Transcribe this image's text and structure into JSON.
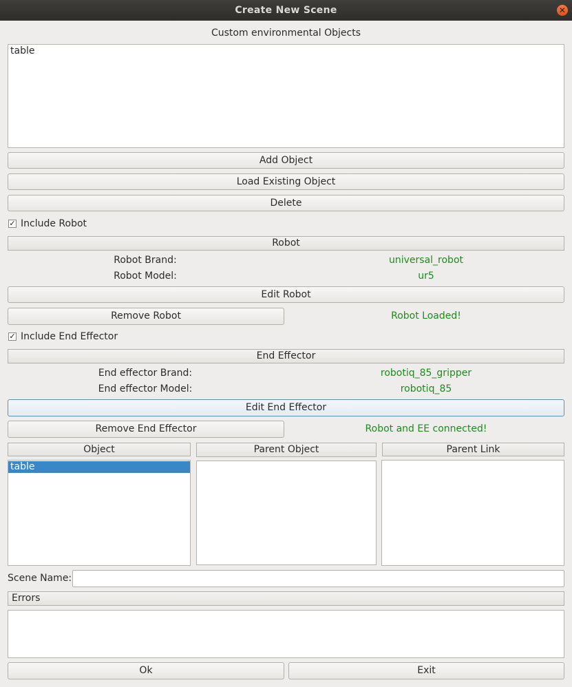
{
  "window": {
    "title": "Create New Scene",
    "close_glyph": "✕"
  },
  "objects_section": {
    "label": "Custom environmental Objects",
    "items": [
      "table"
    ]
  },
  "buttons": {
    "add_object": "Add Object",
    "load_existing": "Load Existing Object",
    "delete": "Delete",
    "edit_robot": "Edit Robot",
    "remove_robot": "Remove Robot",
    "edit_end_effector": "Edit End Effector",
    "remove_end_effector": "Remove End Effector",
    "ok": "Ok",
    "exit": "Exit"
  },
  "robot": {
    "include_label": "Include Robot",
    "include_checked": true,
    "header": "Robot",
    "brand_label": "Robot Brand:",
    "brand_value": "universal_robot",
    "model_label": "Robot Model:",
    "model_value": "ur5",
    "status": "Robot Loaded!"
  },
  "end_effector": {
    "include_label": "Include End Effector",
    "include_checked": true,
    "header": "End Effector",
    "brand_label": "End effector Brand:",
    "brand_value": "robotiq_85_gripper",
    "model_label": "End effector Model:",
    "model_value": "robotiq_85",
    "status": "Robot and EE connected!"
  },
  "parenting": {
    "object_header": "Object",
    "parent_object_header": "Parent Object",
    "parent_link_header": "Parent Link",
    "objects": [
      "table"
    ],
    "selected_object": "table"
  },
  "scene": {
    "name_label": "Scene Name:",
    "name_value": ""
  },
  "errors": {
    "header": "Errors"
  },
  "colors": {
    "status_green": "#1f8a1f",
    "selection_blue": "#3a87c8",
    "titlebar": "#35342f"
  },
  "check_glyph": "✓"
}
